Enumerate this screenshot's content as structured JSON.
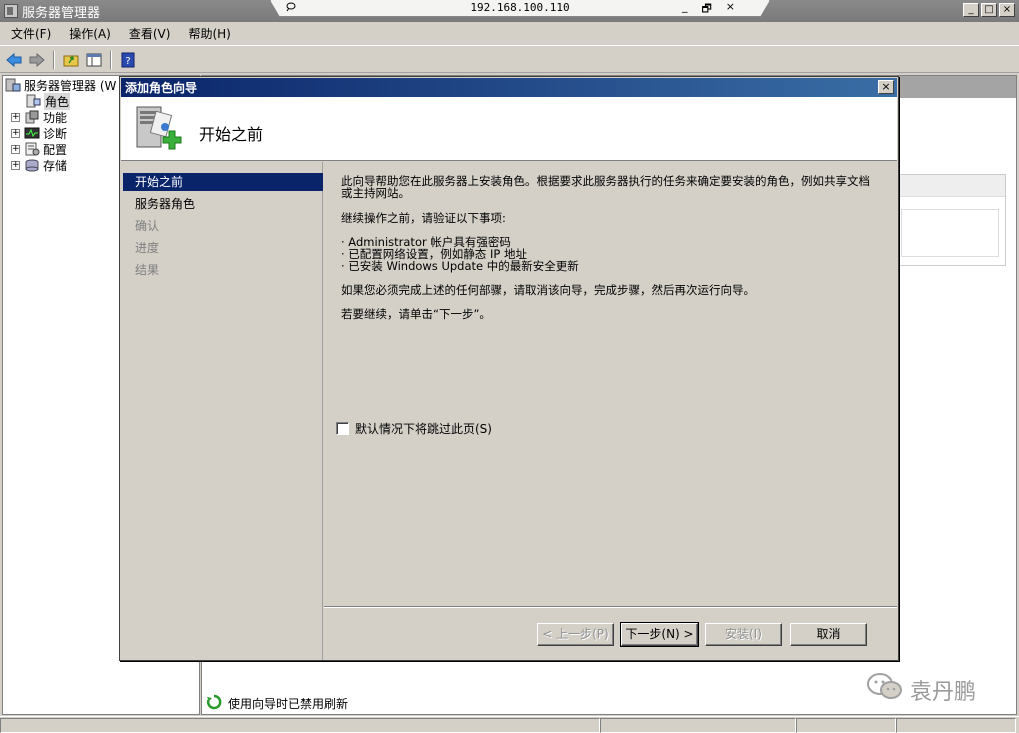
{
  "app": {
    "title": "服务器管理器",
    "window_buttons": [
      "_",
      "□",
      "×"
    ]
  },
  "remote": {
    "ip": "192.168.100.110",
    "controls": [
      "_",
      "🗗",
      "×"
    ]
  },
  "menu": {
    "items": [
      "文件(F)",
      "操作(A)",
      "查看(V)",
      "帮助(H)"
    ]
  },
  "tree": {
    "root": "服务器管理器 (W",
    "items": [
      {
        "label": "角色",
        "expander": ""
      },
      {
        "label": "功能",
        "expander": "+"
      },
      {
        "label": "诊断",
        "expander": "+"
      },
      {
        "label": "配置",
        "expander": "+"
      },
      {
        "label": "存储",
        "expander": "+"
      }
    ]
  },
  "status": {
    "refresh_disabled": "使用向导时已禁用刷新"
  },
  "watermark": {
    "text": "袁丹鹏"
  },
  "dialog": {
    "title": "添加角色向导",
    "close": "×",
    "page_title": "开始之前",
    "nav": [
      {
        "label": "开始之前",
        "state": "active"
      },
      {
        "label": "服务器角色",
        "state": "normal"
      },
      {
        "label": "确认",
        "state": "disabled"
      },
      {
        "label": "进度",
        "state": "disabled"
      },
      {
        "label": "结果",
        "state": "disabled"
      }
    ],
    "content": {
      "intro": "此向导帮助您在此服务器上安装角色。根据要求此服务器执行的任务来确定要安装的角色，例如共享文档或主持网站。",
      "verify": "继续操作之前，请验证以下事项:",
      "bullets": [
        "· Administrator 帐户具有强密码",
        "· 已配置网络设置，例如静态 IP 地址",
        "· 已安装 Windows Update 中的最新安全更新"
      ],
      "cancel_note": "如果您必须完成上述的任何部骤，请取消该向导，完成步骤，然后再次运行向导。",
      "continue_note": "若要继续，请单击“下一步”。",
      "skip_label": "默认情况下将跳过此页(S)"
    },
    "buttons": {
      "prev": "< 上一步(P)",
      "next": "下一步(N) >",
      "install": "安装(I)",
      "cancel": "取消"
    }
  }
}
